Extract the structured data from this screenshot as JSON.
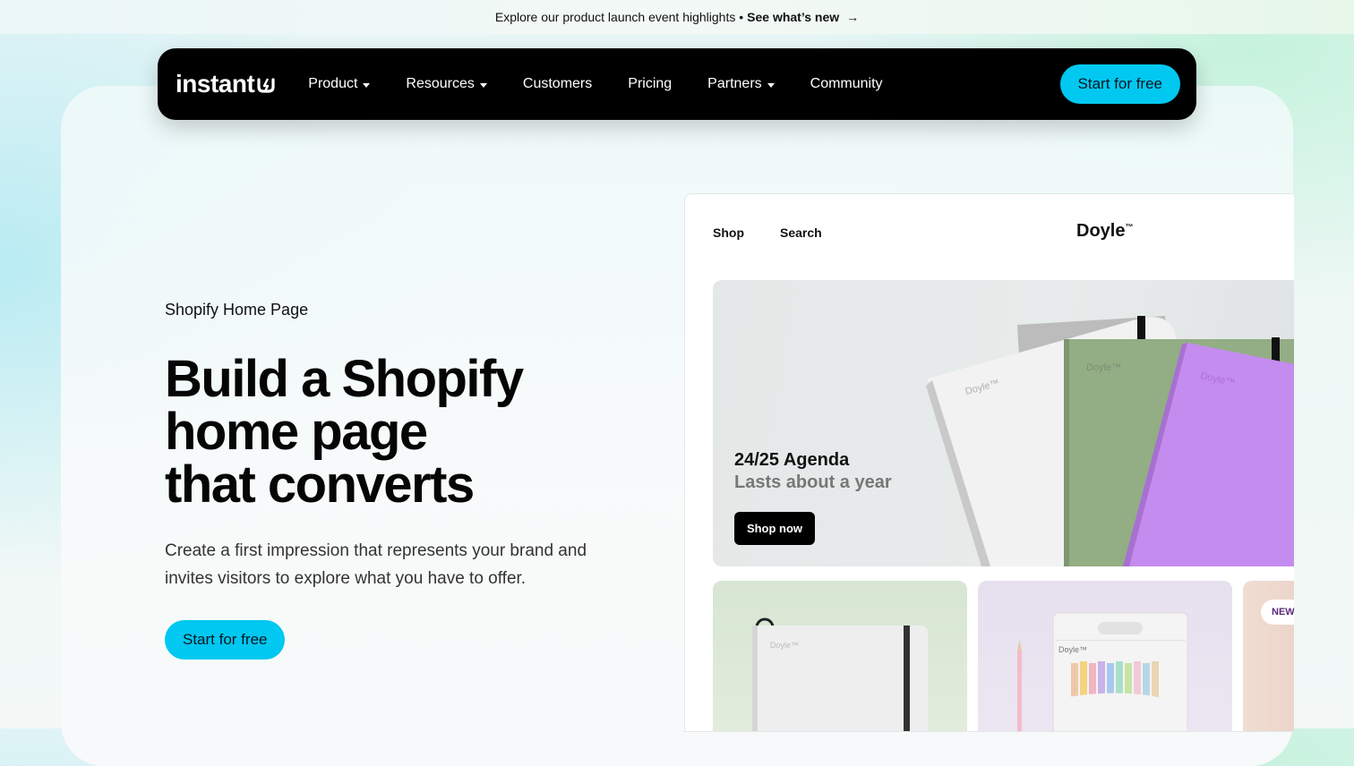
{
  "announcement": {
    "text": "Explore our product launch event highlights •",
    "link": "See what’s new",
    "arrow": "→"
  },
  "nav": {
    "logo": "instant",
    "logo_icon": "instant-mark-icon",
    "items": [
      {
        "label": "Product",
        "dropdown": true
      },
      {
        "label": "Resources",
        "dropdown": true
      },
      {
        "label": "Customers",
        "dropdown": false
      },
      {
        "label": "Pricing",
        "dropdown": false
      },
      {
        "label": "Partners",
        "dropdown": true
      },
      {
        "label": "Community",
        "dropdown": false
      }
    ],
    "cta": "Start for free"
  },
  "hero": {
    "eyebrow": "Shopify Home Page",
    "headline": [
      "Build a Shopify",
      "home page",
      "that converts"
    ],
    "subcopy": "Create a first impression that represents your brand and invites visitors to explore what you have to offer.",
    "cta": "Start for free"
  },
  "preview": {
    "nav": [
      "Shop",
      "Search"
    ],
    "brand": "Doyle",
    "brand_tm": "™",
    "banner": {
      "title": "24/25 Agenda",
      "subtitle": "Lasts about a year",
      "button": "Shop now",
      "product_label": "Doyle™"
    },
    "tiles": [
      {
        "product_label": "Doyle™"
      },
      {
        "product_label": "Doyle™"
      },
      {
        "badge": "NEW"
      }
    ]
  },
  "colors": {
    "accent": "#00c8f0",
    "nav_bg": "#000000",
    "text": "#111111"
  }
}
